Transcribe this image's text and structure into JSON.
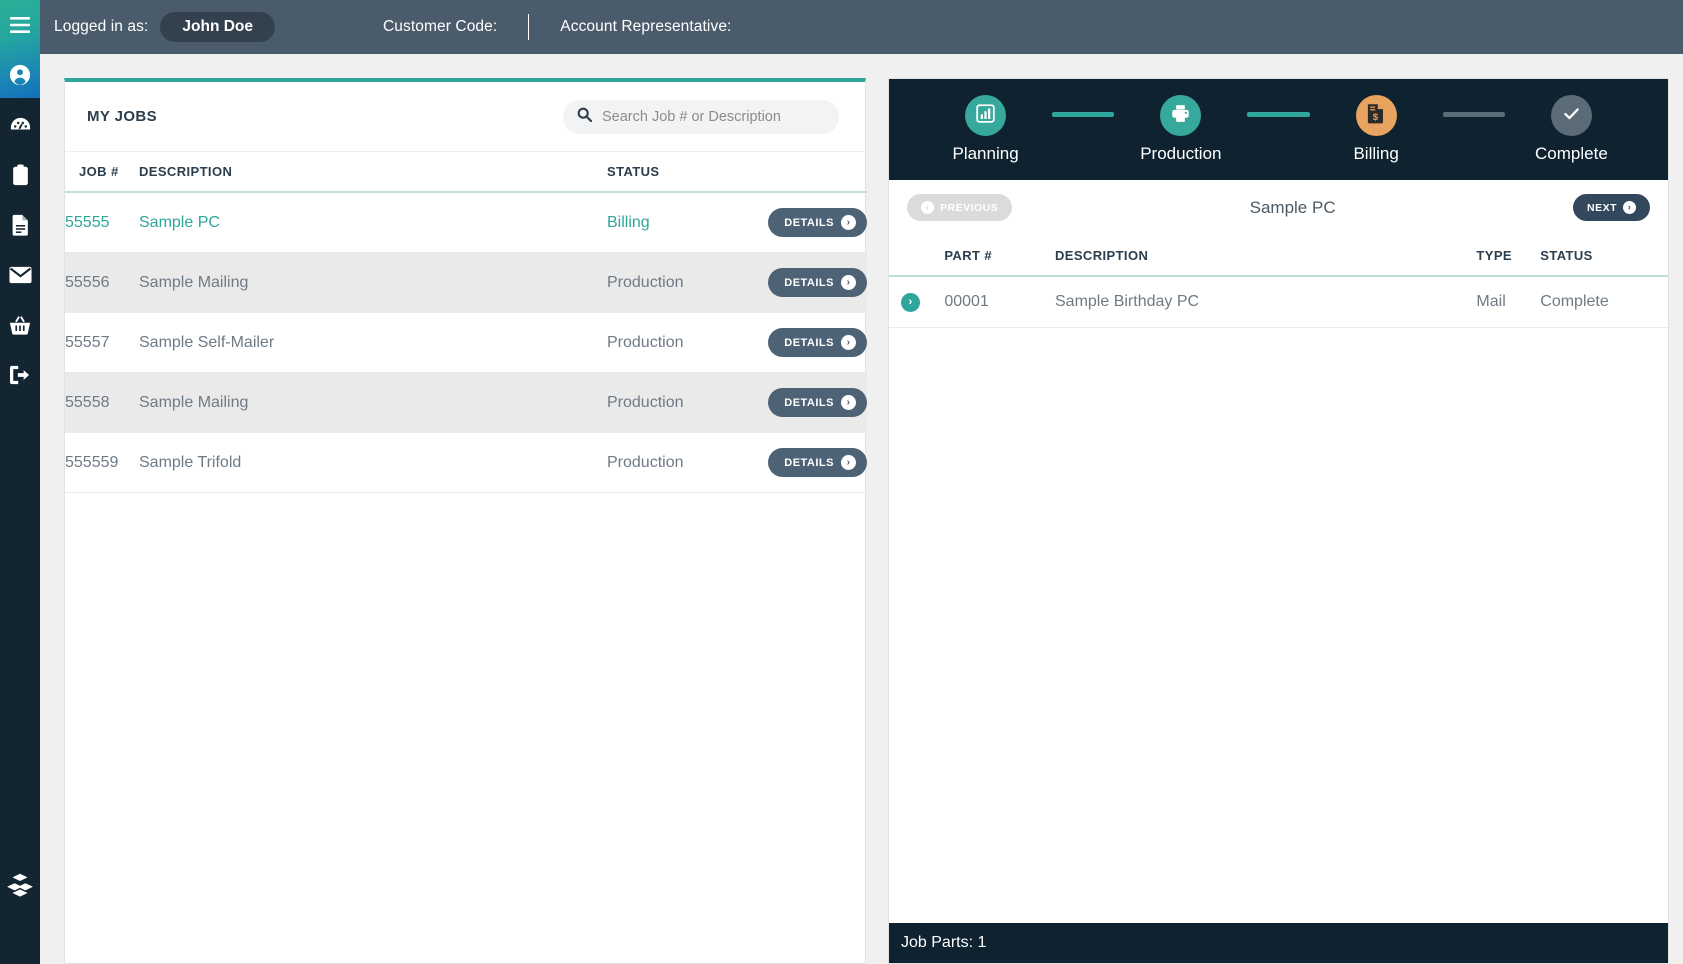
{
  "sidebar": {
    "items": [
      {
        "name": "menu-toggle",
        "icon": "hamburger-icon"
      },
      {
        "name": "account",
        "icon": "user-circle-icon"
      },
      {
        "name": "dashboard",
        "icon": "gauge-icon"
      },
      {
        "name": "orders",
        "icon": "clipboard-icon"
      },
      {
        "name": "documents",
        "icon": "document-icon"
      },
      {
        "name": "messages",
        "icon": "envelope-icon"
      },
      {
        "name": "store",
        "icon": "basket-icon"
      },
      {
        "name": "logout",
        "icon": "logout-icon"
      }
    ],
    "logo_icon": "stacked-diamonds-logo"
  },
  "topbar": {
    "logged_in_label": "Logged in as:",
    "user_name": "John Doe",
    "customer_code_label": "Customer Code:",
    "customer_code_value": "",
    "account_rep_label": "Account Representative:",
    "account_rep_value": ""
  },
  "jobs_panel": {
    "title": "MY JOBS",
    "search": {
      "value": "",
      "placeholder": "Search Job # or Description",
      "icon": "search-icon"
    },
    "columns": [
      "JOB #",
      "DESCRIPTION",
      "STATUS",
      ""
    ],
    "details_button_label": "DETAILS",
    "rows": [
      {
        "job": "55555",
        "description": "Sample PC",
        "status": "Billing",
        "selected": true,
        "alt": false
      },
      {
        "job": "55556",
        "description": "Sample Mailing",
        "status": "Production",
        "selected": false,
        "alt": true
      },
      {
        "job": "55557",
        "description": "Sample Self-Mailer",
        "status": "Production",
        "selected": false,
        "alt": false
      },
      {
        "job": "55558",
        "description": "Sample Mailing",
        "status": "Production",
        "selected": false,
        "alt": true
      },
      {
        "job": "555559",
        "description": "Sample Trifold",
        "status": "Production",
        "selected": false,
        "alt": false
      }
    ]
  },
  "detail_panel": {
    "steps": [
      {
        "label": "Planning",
        "icon": "bar-chart-icon",
        "color": "#37a89c",
        "state": "done"
      },
      {
        "label": "Production",
        "icon": "printer-icon",
        "color": "#37a89c",
        "state": "done"
      },
      {
        "label": "Billing",
        "icon": "invoice-icon",
        "color": "#e8a35e",
        "state": "current"
      },
      {
        "label": "Complete",
        "icon": "check-icon",
        "color": "#5b6b78",
        "state": "pending"
      }
    ],
    "connectors": [
      "#2fa69b",
      "#2fa69b",
      "#5b6b78"
    ],
    "previous_label": "PREVIOUS",
    "next_label": "NEXT",
    "title": "Sample PC",
    "columns": [
      "PART #",
      "DESCRIPTION",
      "TYPE",
      "STATUS"
    ],
    "rows": [
      {
        "part": "00001",
        "description": "Sample Birthday PC",
        "type": "Mail",
        "status": "Complete"
      }
    ],
    "footer": "Job Parts: 1"
  },
  "colors": {
    "accent_teal": "#2fa69b",
    "navy": "#0e2230",
    "topbar": "#4a5c6b",
    "slate_button": "#4d6275",
    "orange": "#e8a35e"
  }
}
